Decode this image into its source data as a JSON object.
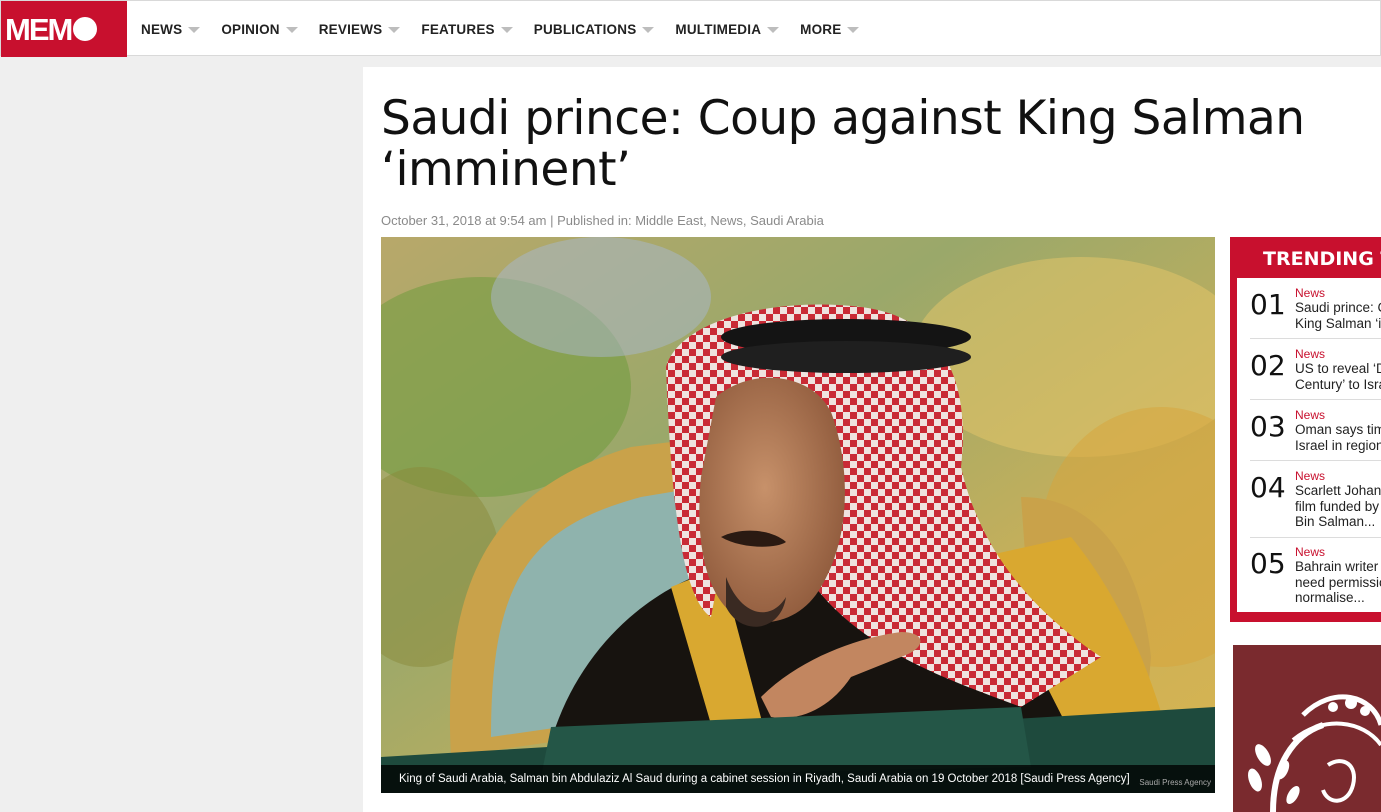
{
  "site": {
    "logo_text": "MEM"
  },
  "nav": {
    "items": [
      {
        "label": "NEWS"
      },
      {
        "label": "OPINION"
      },
      {
        "label": "REVIEWS"
      },
      {
        "label": "FEATURES"
      },
      {
        "label": "PUBLICATIONS"
      },
      {
        "label": "MULTIMEDIA"
      },
      {
        "label": "MORE"
      }
    ]
  },
  "article": {
    "title": "Saudi prince: Coup against King Salman ‘imminent’",
    "date": "October 31, 2018 at 9:54 am",
    "published_prefix": "Published in:",
    "categories": [
      "Middle East",
      "News",
      "Saudi Arabia"
    ],
    "image_caption": "King of Saudi Arabia, Salman bin Abdulaziz Al Saud during a cabinet session in Riyadh, Saudi Arabia on 19 October 2018 [Saudi Press Agency]",
    "image_credit": "Saudi Press Agency"
  },
  "trending": {
    "title": "TRENDING T",
    "items": [
      {
        "num": "01",
        "category": "News",
        "headline": "Saudi prince: C\nKing Salman ‘im"
      },
      {
        "num": "02",
        "category": "News",
        "headline": "US to reveal ‘D\nCentury’ to Isra"
      },
      {
        "num": "03",
        "category": "News",
        "headline": "Oman says tim\nIsrael in region"
      },
      {
        "num": "04",
        "category": "News",
        "headline": "Scarlett Johans\nfilm funded by\nBin Salman..."
      },
      {
        "num": "05",
        "category": "News",
        "headline": "Bahrain writer\nneed permissio\nnormalise..."
      }
    ]
  },
  "colors": {
    "brand": "#c8102e",
    "ad_bg": "#7a2a2e"
  }
}
